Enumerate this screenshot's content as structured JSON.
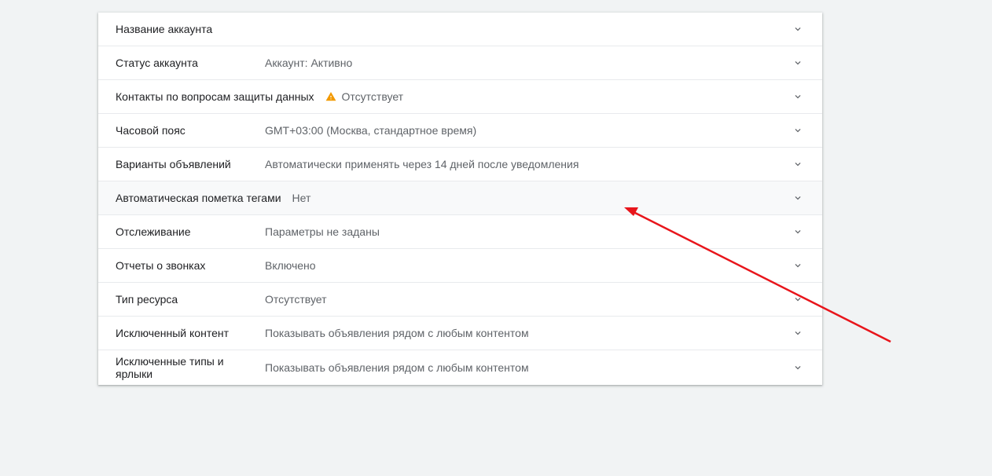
{
  "colors": {
    "warning": "#f29900",
    "annotation_arrow": "#e8151b"
  },
  "rows": [
    {
      "label": "Название аккаунта",
      "value": ""
    },
    {
      "label": "Статус аккаунта",
      "value": "Аккаунт: Активно"
    },
    {
      "label": "Контакты по вопросам защиты данных",
      "value": "Отсутствует",
      "icon": "warning-icon"
    },
    {
      "label": "Часовой пояс",
      "value": "GMT+03:00 (Москва, стандартное время)"
    },
    {
      "label": "Варианты объявлений",
      "value": "Автоматически применять через 14 дней после уведомления"
    },
    {
      "label": "Автоматическая пометка тегами",
      "value": "Нет"
    },
    {
      "label": "Отслеживание",
      "value": "Параметры не заданы"
    },
    {
      "label": "Отчеты о звонках",
      "value": "Включено"
    },
    {
      "label": "Тип ресурса",
      "value": "Отсутствует"
    },
    {
      "label": "Исключенный контент",
      "value": "Показывать объявления рядом с любым контентом"
    },
    {
      "label": "Исключенные типы и ярлыки",
      "value": "Показывать объявления рядом с любым контентом"
    }
  ]
}
